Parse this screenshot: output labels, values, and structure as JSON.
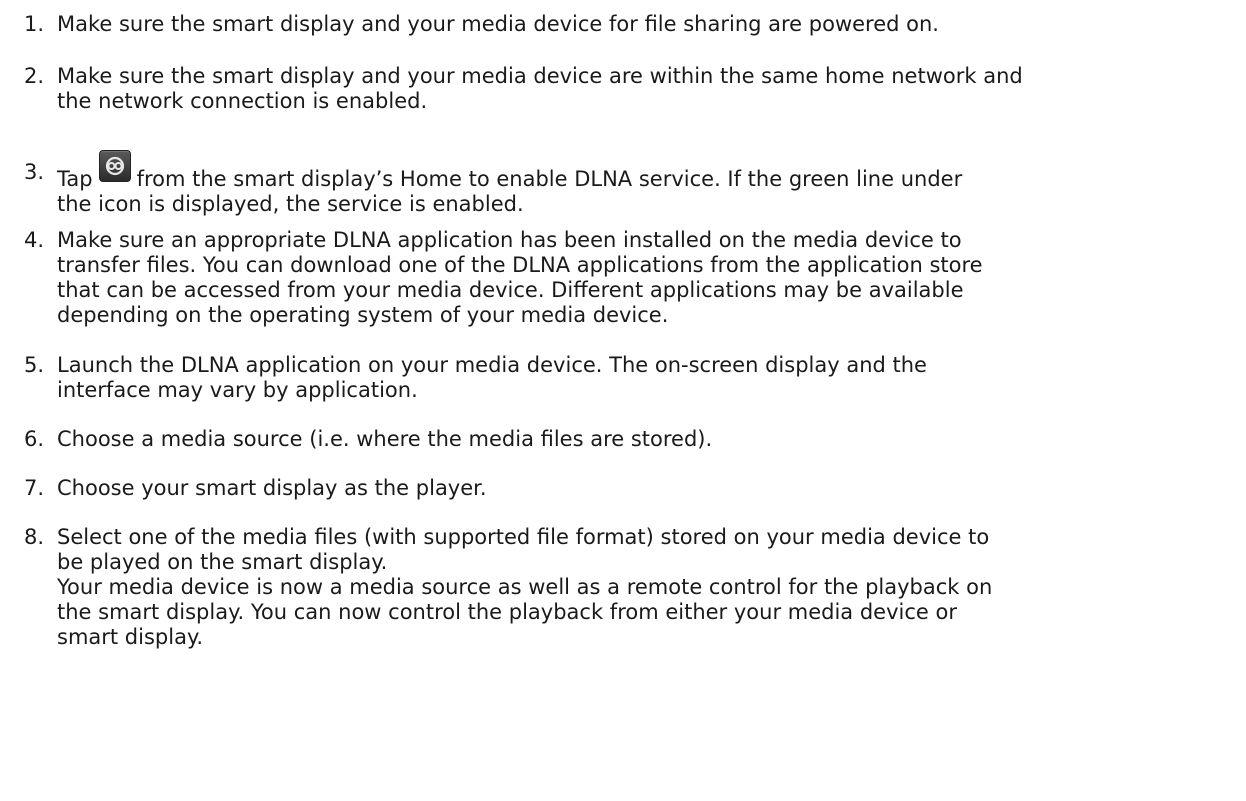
{
  "steps": [
    {
      "number": "1.",
      "lines": [
        "Make sure the smart display and your media device for file sharing are powered on."
      ]
    },
    {
      "number": "2.",
      "lines": [
        "Make sure the smart display and your media device are within the same home network and",
        "the network connection is enabled."
      ]
    },
    {
      "number": "3.",
      "lines": [
        {
          "before_icon": "Tap",
          "icon": "dlna-share-icon",
          "after_icon": "from the smart display’s Home to enable DLNA service. If the green line under"
        },
        "the icon is displayed, the service is enabled."
      ]
    },
    {
      "number": "4.",
      "lines": [
        "Make sure an appropriate DLNA application has been installed on the media device to",
        "transfer files. You can download one of the DLNA applications from the application store",
        "that can be accessed from your media device. Different applications may be available",
        "depending on the operating system of your media device."
      ]
    },
    {
      "number": "5.",
      "lines": [
        "Launch the DLNA application on your media device. The on-screen display and the",
        "interface may vary by application."
      ]
    },
    {
      "number": "6.",
      "lines": [
        "Choose a media source (i.e. where the media files are stored)."
      ]
    },
    {
      "number": "7.",
      "lines": [
        "Choose your smart display as the player."
      ]
    },
    {
      "number": "8.",
      "lines": [
        "Select one of the media files (with supported file format) stored on your media device to",
        "be played on the smart display.",
        "Your media device is now a media source as well as a remote control for the playback on",
        "the smart display. You can now control the playback from either your media device or",
        "smart display."
      ]
    }
  ]
}
